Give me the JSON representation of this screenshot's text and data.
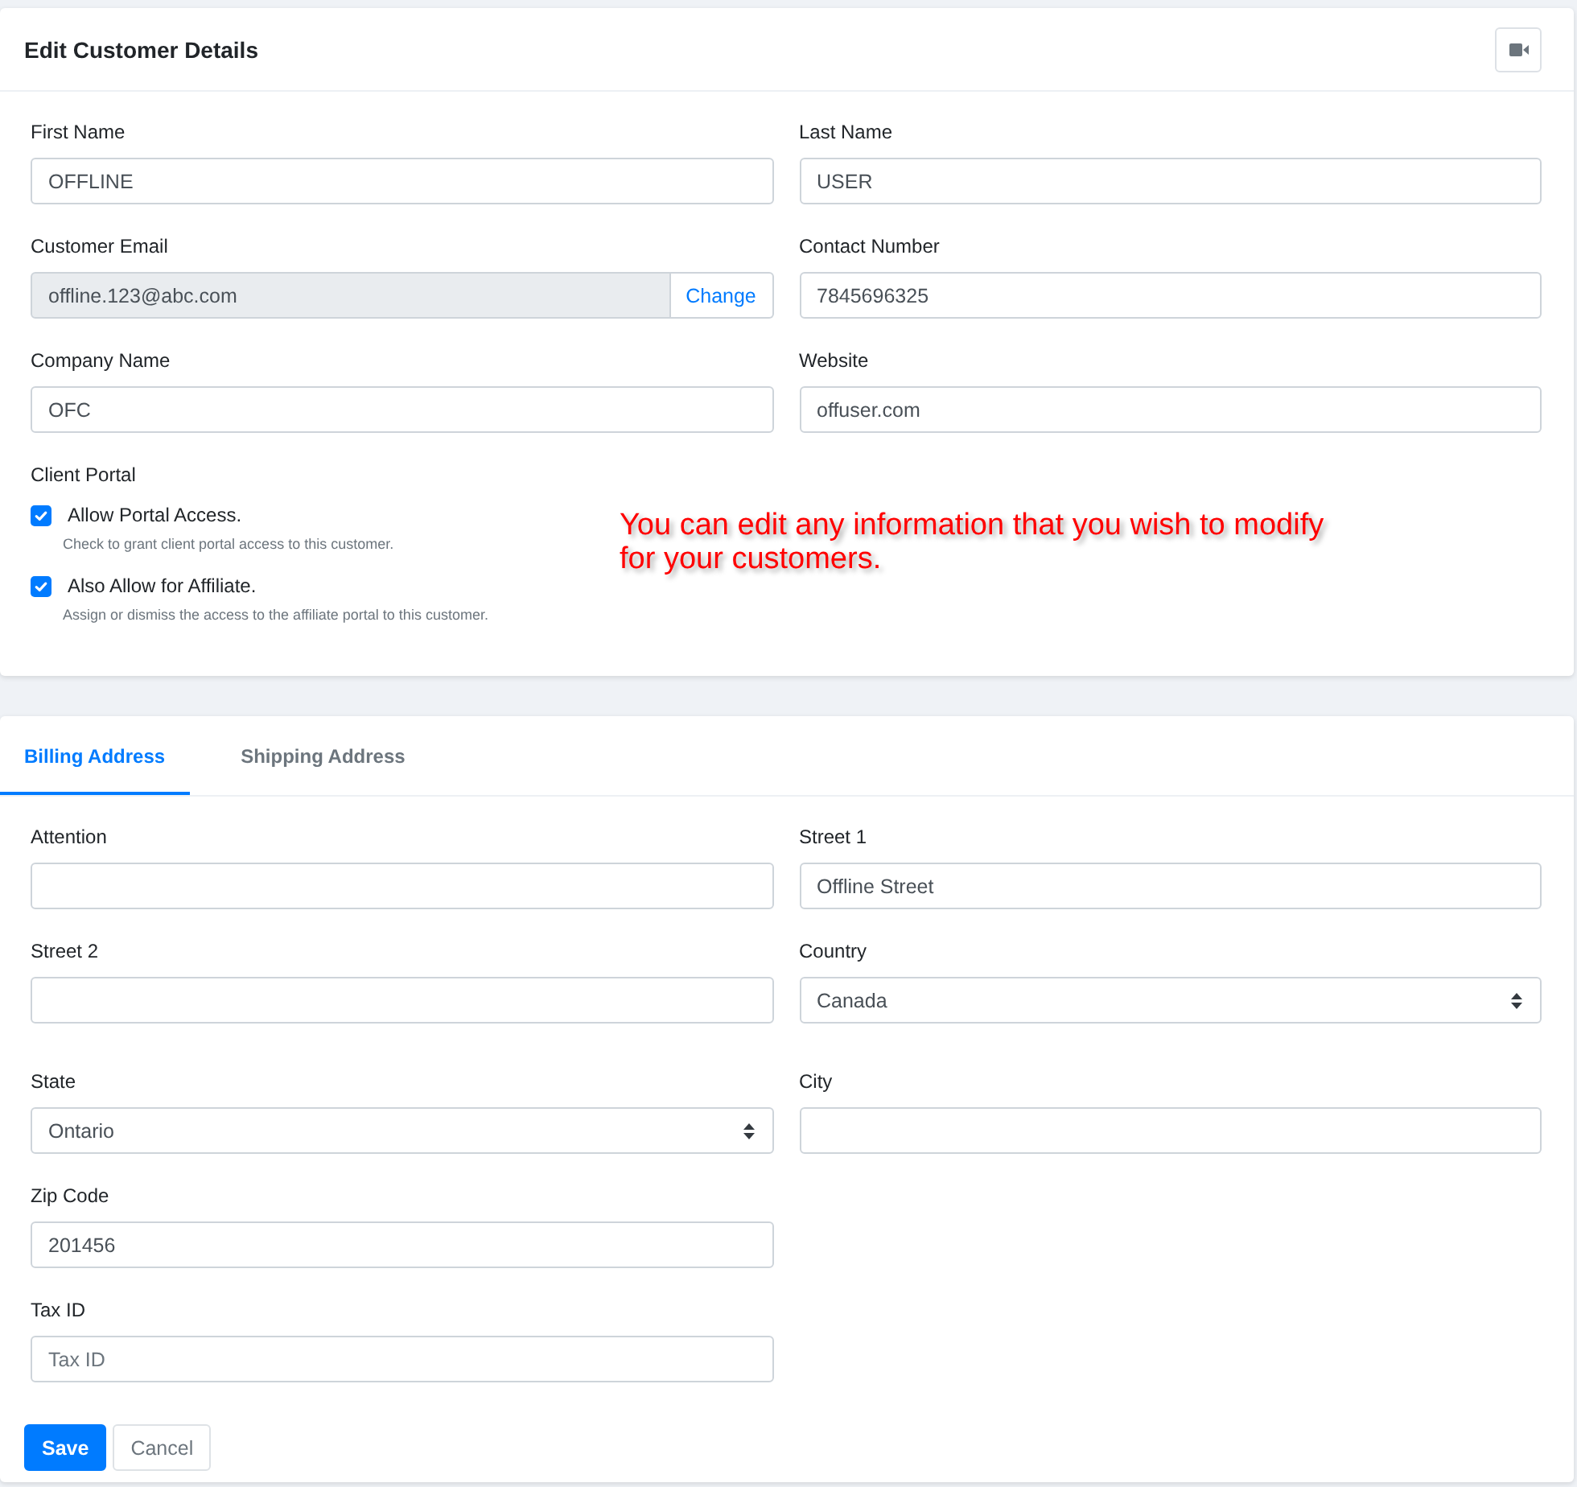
{
  "customer_card": {
    "title": "Edit Customer Details",
    "rows": [
      [
        {
          "kind": "text",
          "label": "First Name",
          "value": "OFFLINE"
        },
        {
          "kind": "text",
          "label": "Last Name",
          "value": "USER"
        }
      ],
      [
        {
          "kind": "email",
          "label": "Customer Email",
          "value": "offline.123@abc.com",
          "disabled": true,
          "action": "Change"
        },
        {
          "kind": "text",
          "label": "Contact Number",
          "value": "7845696325"
        }
      ],
      [
        {
          "kind": "text",
          "label": "Company Name",
          "value": "OFC"
        },
        {
          "kind": "text",
          "label": "Website",
          "value": "offuser.com"
        }
      ]
    ],
    "client_portal": {
      "label": "Client Portal",
      "options": [
        {
          "label": "Allow Portal Access.",
          "hint": "Check to grant client portal access to this customer.",
          "checked": true
        },
        {
          "label": "Also Allow for Affiliate.",
          "hint": "Assign or dismiss the access to the affiliate portal to this customer.",
          "checked": true
        }
      ]
    },
    "annotation": "You can edit any information that you wish to modify for your customers."
  },
  "address_card": {
    "tabs": [
      {
        "label": "Billing Address",
        "selected": true
      },
      {
        "label": "Shipping Address",
        "selected": false
      }
    ],
    "rows": [
      [
        {
          "kind": "text",
          "label": "Attention"
        },
        {
          "kind": "text",
          "label": "Street 1",
          "value": "Offline Street"
        }
      ],
      [
        {
          "kind": "text",
          "label": "Street 2"
        },
        {
          "kind": "select",
          "label": "Country",
          "value": "Canada"
        }
      ],
      [
        {
          "kind": "select",
          "label": "State",
          "value": "Ontario"
        },
        {
          "kind": "text",
          "label": "City"
        }
      ],
      [
        {
          "kind": "text",
          "label": "Zip Code",
          "value": "201456"
        }
      ],
      [
        {
          "kind": "text",
          "label": "Tax ID",
          "placeholder": "Tax ID"
        }
      ]
    ],
    "buttons": [
      {
        "kind": "primary",
        "label": "Save"
      },
      {
        "kind": "secondary",
        "label": "Cancel"
      }
    ]
  }
}
